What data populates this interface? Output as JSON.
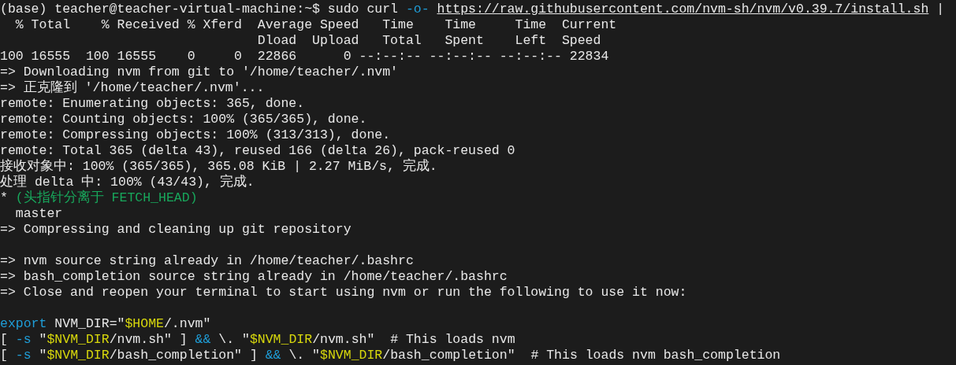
{
  "terminal": {
    "lines": [
      {
        "kind": "text",
        "segments": [
          {
            "kind": "plain",
            "text": "(base) teacher@teacher-virtual-machine:~$ sudo curl "
          },
          {
            "kind": "flag",
            "text": "-o- "
          },
          {
            "kind": "link",
            "text": "https://raw.githubusercontent.com/nvm-sh/nvm/v0.39.7/install.sh"
          },
          {
            "kind": "plain",
            "text": " |"
          }
        ]
      },
      {
        "kind": "text",
        "segments": [
          {
            "kind": "plain",
            "text": "  % Total    % Received % Xferd  Average Speed   Time    Time     Time  Current"
          }
        ]
      },
      {
        "kind": "text",
        "segments": [
          {
            "kind": "plain",
            "text": "                                 Dload  Upload   Total   Spent    Left  Speed"
          }
        ]
      },
      {
        "kind": "text",
        "segments": [
          {
            "kind": "plain",
            "text": "100 16555  100 16555    0     0  22866      0 --:--:-- --:--:-- --:--:-- 22834"
          }
        ]
      },
      {
        "kind": "text",
        "segments": [
          {
            "kind": "plain",
            "text": "=> Downloading nvm from git to '/home/teacher/.nvm'"
          }
        ]
      },
      {
        "kind": "text",
        "segments": [
          {
            "kind": "plain",
            "text": "=> 正克隆到 '/home/teacher/.nvm'..."
          }
        ]
      },
      {
        "kind": "text",
        "segments": [
          {
            "kind": "plain",
            "text": "remote: Enumerating objects: 365, done."
          }
        ]
      },
      {
        "kind": "text",
        "segments": [
          {
            "kind": "plain",
            "text": "remote: Counting objects: 100% (365/365), done."
          }
        ]
      },
      {
        "kind": "text",
        "segments": [
          {
            "kind": "plain",
            "text": "remote: Compressing objects: 100% (313/313), done."
          }
        ]
      },
      {
        "kind": "text",
        "segments": [
          {
            "kind": "plain",
            "text": "remote: Total 365 (delta 43), reused 166 (delta 26), pack-reused 0"
          }
        ]
      },
      {
        "kind": "text",
        "segments": [
          {
            "kind": "plain",
            "text": "接收对象中: 100% (365/365), 365.08 KiB | 2.27 MiB/s, 完成."
          }
        ]
      },
      {
        "kind": "text",
        "segments": [
          {
            "kind": "plain",
            "text": "处理 delta 中: 100% (43/43), 完成."
          }
        ]
      },
      {
        "kind": "text",
        "segments": [
          {
            "kind": "plain",
            "text": "* "
          },
          {
            "kind": "branch",
            "text": "(头指针分离于 FETCH_HEAD)"
          }
        ]
      },
      {
        "kind": "text",
        "segments": [
          {
            "kind": "plain",
            "text": "  master"
          }
        ]
      },
      {
        "kind": "text",
        "segments": [
          {
            "kind": "plain",
            "text": "=> Compressing and cleaning up git repository"
          }
        ]
      },
      {
        "kind": "blank"
      },
      {
        "kind": "text",
        "segments": [
          {
            "kind": "plain",
            "text": "=> nvm source string already in /home/teacher/.bashrc"
          }
        ]
      },
      {
        "kind": "text",
        "segments": [
          {
            "kind": "plain",
            "text": "=> bash_completion source string already in /home/teacher/.bashrc"
          }
        ]
      },
      {
        "kind": "text",
        "segments": [
          {
            "kind": "plain",
            "text": "=> Close and reopen your terminal to start using nvm or run the following to use it now:"
          }
        ]
      },
      {
        "kind": "blank"
      },
      {
        "kind": "text",
        "segments": [
          {
            "kind": "keyword",
            "text": "export"
          },
          {
            "kind": "plain",
            "text": " NVM_DIR=\""
          },
          {
            "kind": "variable",
            "text": "$HOME"
          },
          {
            "kind": "plain",
            "text": "/.nvm\""
          }
        ]
      },
      {
        "kind": "text",
        "segments": [
          {
            "kind": "plain",
            "text": "[ "
          },
          {
            "kind": "flag",
            "text": "-s"
          },
          {
            "kind": "plain",
            "text": " \""
          },
          {
            "kind": "variable",
            "text": "$NVM_DIR"
          },
          {
            "kind": "plain",
            "text": "/nvm.sh\" ] "
          },
          {
            "kind": "keyword",
            "text": "&&"
          },
          {
            "kind": "plain",
            "text": " \\. \""
          },
          {
            "kind": "variable",
            "text": "$NVM_DIR"
          },
          {
            "kind": "plain",
            "text": "/nvm.sh\"  # This loads nvm"
          }
        ]
      },
      {
        "kind": "text",
        "segments": [
          {
            "kind": "plain",
            "text": "[ "
          },
          {
            "kind": "flag",
            "text": "-s"
          },
          {
            "kind": "plain",
            "text": " \""
          },
          {
            "kind": "variable",
            "text": "$NVM_DIR"
          },
          {
            "kind": "plain",
            "text": "/bash_completion\" ] "
          },
          {
            "kind": "keyword",
            "text": "&&"
          },
          {
            "kind": "plain",
            "text": " \\. \""
          },
          {
            "kind": "variable",
            "text": "$NVM_DIR"
          },
          {
            "kind": "plain",
            "text": "/bash_completion\"  # This loads nvm bash_completion"
          }
        ]
      }
    ]
  }
}
